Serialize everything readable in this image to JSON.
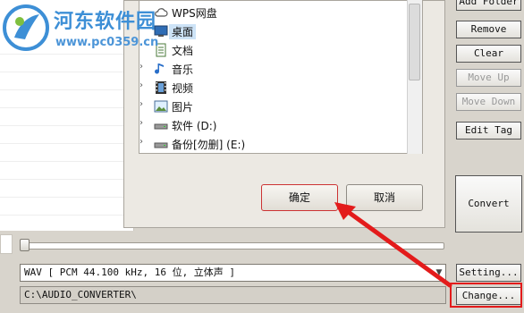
{
  "watermark": {
    "title": "河东软件园",
    "url": "www.pc0359.cn"
  },
  "folder_tree": {
    "items": [
      {
        "label": "WPS网盘",
        "icon": "cloud-drive-icon",
        "expandable": false,
        "selected": false
      },
      {
        "label": "桌面",
        "icon": "desktop-icon",
        "expandable": false,
        "selected": true
      },
      {
        "label": "文档",
        "icon": "document-icon",
        "expandable": false,
        "selected": false
      },
      {
        "label": "音乐",
        "icon": "music-icon",
        "expandable": true,
        "selected": false
      },
      {
        "label": "视频",
        "icon": "video-icon",
        "expandable": true,
        "selected": false
      },
      {
        "label": "图片",
        "icon": "picture-icon",
        "expandable": true,
        "selected": false
      },
      {
        "label": "软件 (D:)",
        "icon": "drive-icon",
        "expandable": true,
        "selected": false
      },
      {
        "label": "备份[勿删] (E:)",
        "icon": "drive-icon",
        "expandable": true,
        "selected": false
      }
    ]
  },
  "dialog": {
    "ok_label": "确定",
    "cancel_label": "取消"
  },
  "sidebar": {
    "add_folder": "Add Folder",
    "remove": "Remove",
    "clear": "Clear",
    "move_up": "Move Up",
    "move_down": "Move Down",
    "edit_tag": "Edit Tag",
    "convert": "Convert"
  },
  "output": {
    "format": "WAV [ PCM 44.100 kHz, 16 位, 立体声 ]",
    "setting_label": "Setting...",
    "path": "C:\\AUDIO_CONVERTER\\",
    "change_label": "Change..."
  },
  "colors": {
    "highlight": "#e31b1b",
    "watermark": "#3d8fd6",
    "selection": "#cde3f7"
  }
}
